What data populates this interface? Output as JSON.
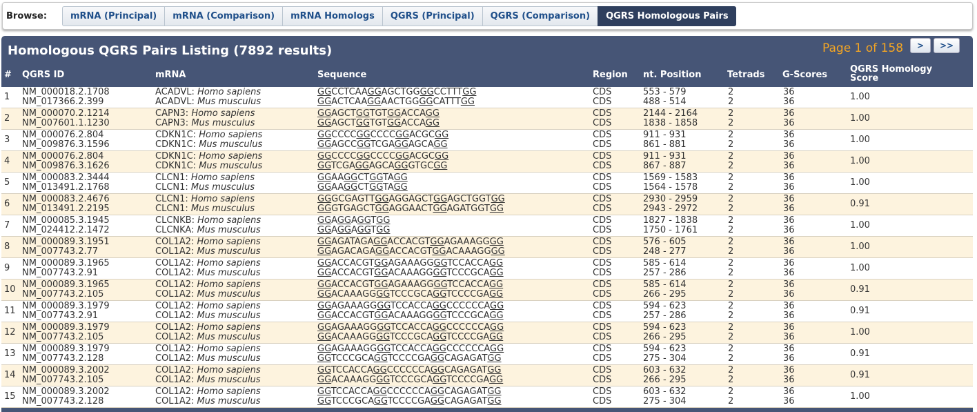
{
  "browse": {
    "label": "Browse:",
    "tabs": [
      {
        "label": "mRNA (Principal)"
      },
      {
        "label": "mRNA (Comparison)"
      },
      {
        "label": "mRNA Homologs"
      },
      {
        "label": "QGRS (Principal)"
      },
      {
        "label": "QGRS (Comparison)"
      },
      {
        "label": "QGRS Homologous Pairs",
        "active": true
      }
    ]
  },
  "panel": {
    "title": "Homologous QGRS Pairs Listing (7892 results)",
    "pager": {
      "text": "Page 1 of 158",
      "next": ">",
      "last": ">>"
    }
  },
  "columns": {
    "num": "#",
    "qgrs_id": "QGRS ID",
    "mrna": "mRNA",
    "sequence": "Sequence",
    "region": "Region",
    "position": "nt. Position",
    "tetrads": "Tetrads",
    "gscores": "G-Scores",
    "score": "QGRS Homology Score"
  },
  "rows": [
    {
      "n": "1",
      "ids": [
        "NM_000018.2.1708",
        "NM_017366.2.399"
      ],
      "gene": [
        "ACADVL:",
        "ACADVL:"
      ],
      "species": [
        "Homo sapiens",
        "Mus musculus"
      ],
      "seq": [
        [
          "GG",
          "CCTCAA",
          "GG",
          "AGCTGG",
          "GG",
          "CCTTT",
          "GG"
        ],
        [
          "GG",
          "ACTCAA",
          "GG",
          "AACTGG",
          "GG",
          "CATTT",
          "GG"
        ]
      ],
      "region": [
        "CDS",
        "CDS"
      ],
      "pos": [
        "553 - 579",
        "488 - 514"
      ],
      "tetrads": [
        "2",
        "2"
      ],
      "gs": [
        "36",
        "36"
      ],
      "score": "1.00"
    },
    {
      "n": "2",
      "ids": [
        "NM_000070.2.1214",
        "NM_007601.1.1230"
      ],
      "gene": [
        "CAPN3:",
        "CAPN3:"
      ],
      "species": [
        "Homo sapiens",
        "Mus musculus"
      ],
      "seq": [
        [
          "GG",
          "AGCT",
          "GG",
          "TGT",
          "GG",
          "ACCA",
          "GG"
        ],
        [
          "GG",
          "AGCT",
          "GG",
          "TGT",
          "GG",
          "ACCA",
          "GG"
        ]
      ],
      "region": [
        "CDS",
        "CDS"
      ],
      "pos": [
        "2144 - 2164",
        "1838 - 1858"
      ],
      "tetrads": [
        "2",
        "2"
      ],
      "gs": [
        "36",
        "36"
      ],
      "score": "1.00"
    },
    {
      "n": "3",
      "ids": [
        "NM_000076.2.804",
        "NM_009876.3.1596"
      ],
      "gene": [
        "CDKN1C:",
        "CDKN1C:"
      ],
      "species": [
        "Homo sapiens",
        "Mus musculus"
      ],
      "seq": [
        [
          "GG",
          "CCCC",
          "GG",
          "CCCC",
          "GG",
          "ACGC",
          "GG"
        ],
        [
          "GG",
          "AGCC",
          "GG",
          "TCGA",
          "GG",
          "AGCA",
          "GG"
        ]
      ],
      "region": [
        "CDS",
        "CDS"
      ],
      "pos": [
        "911 - 931",
        "861 - 881"
      ],
      "tetrads": [
        "2",
        "2"
      ],
      "gs": [
        "36",
        "36"
      ],
      "score": "1.00"
    },
    {
      "n": "4",
      "ids": [
        "NM_000076.2.804",
        "NM_009876.3.1626"
      ],
      "gene": [
        "CDKN1C:",
        "CDKN1C:"
      ],
      "species": [
        "Homo sapiens",
        "Mus musculus"
      ],
      "seq": [
        [
          "GG",
          "CCCC",
          "GG",
          "CCCC",
          "GG",
          "ACGC",
          "GG"
        ],
        [
          "GG",
          "TCGA",
          "GG",
          "AGCA",
          "GG",
          "GTGC",
          "GG"
        ]
      ],
      "region": [
        "CDS",
        "CDS"
      ],
      "pos": [
        "911 - 931",
        "867 - 887"
      ],
      "tetrads": [
        "2",
        "2"
      ],
      "gs": [
        "36",
        "36"
      ],
      "score": "1.00"
    },
    {
      "n": "5",
      "ids": [
        "NM_000083.2.3444",
        "NM_013491.2.1768"
      ],
      "gene": [
        "CLCN1:",
        "CLCN1:"
      ],
      "species": [
        "Homo sapiens",
        "Mus musculus"
      ],
      "seq": [
        [
          "GG",
          "AA",
          "GG",
          "CT",
          "GG",
          "TA",
          "GG"
        ],
        [
          "GG",
          "AA",
          "GG",
          "CT",
          "GG",
          "TA",
          "GG"
        ]
      ],
      "region": [
        "CDS",
        "CDS"
      ],
      "pos": [
        "1569 - 1583",
        "1564 - 1578"
      ],
      "tetrads": [
        "2",
        "2"
      ],
      "gs": [
        "36",
        "36"
      ],
      "score": "1.00"
    },
    {
      "n": "6",
      "ids": [
        "NM_000083.2.4676",
        "NM_013491.2.2195"
      ],
      "gene": [
        "CLCN1:",
        "CLCN1:"
      ],
      "species": [
        "Homo sapiens",
        "Mus musculus"
      ],
      "seq": [
        [
          "GG",
          "GCGAGTT",
          "GG",
          "AGGAGCT",
          "GG",
          "AGCTGGT",
          "GG"
        ],
        [
          "GG",
          "GTGAGCT",
          "GG",
          "AGGAACT",
          "GG",
          "AGATGGT",
          "GG"
        ]
      ],
      "region": [
        "CDS",
        "CDS"
      ],
      "pos": [
        "2930 - 2959",
        "2943 - 2972"
      ],
      "tetrads": [
        "2",
        "2"
      ],
      "gs": [
        "36",
        "36"
      ],
      "score": "0.91"
    },
    {
      "n": "7",
      "ids": [
        "NM_000085.3.1945",
        "NM_024412.2.1472"
      ],
      "gene": [
        "CLCNKB:",
        "CLCNKA:"
      ],
      "species": [
        "Homo sapiens",
        "Mus musculus"
      ],
      "seq": [
        [
          "GG",
          "A",
          "GG",
          "A",
          "GG",
          "T",
          "GG"
        ],
        [
          "GG",
          "A",
          "GG",
          "A",
          "GG",
          "T",
          "GG"
        ]
      ],
      "region": [
        "CDS",
        "CDS"
      ],
      "pos": [
        "1827 - 1838",
        "1750 - 1761"
      ],
      "tetrads": [
        "2",
        "2"
      ],
      "gs": [
        "36",
        "36"
      ],
      "score": "1.00"
    },
    {
      "n": "8",
      "ids": [
        "NM_000089.3.1951",
        "NM_007743.2.77"
      ],
      "gene": [
        "COL1A2:",
        "COL1A2:"
      ],
      "species": [
        "Homo sapiens",
        "Mus musculus"
      ],
      "seq": [
        [
          "GG",
          "AGATAGA",
          "GG",
          "ACCACGT",
          "GG",
          "AGAAAGG",
          "GG"
        ],
        [
          "GG",
          "AGACAGA",
          "GG",
          "ACCACGT",
          "GG",
          "ACAAAGG",
          "GG"
        ]
      ],
      "region": [
        "CDS",
        "CDS"
      ],
      "pos": [
        "576 - 605",
        "248 - 277"
      ],
      "tetrads": [
        "2",
        "2"
      ],
      "gs": [
        "36",
        "36"
      ],
      "score": "1.00"
    },
    {
      "n": "9",
      "ids": [
        "NM_000089.3.1965",
        "NM_007743.2.91"
      ],
      "gene": [
        "COL1A2:",
        "COL1A2:"
      ],
      "species": [
        "Homo sapiens",
        "Mus musculus"
      ],
      "seq": [
        [
          "GG",
          "ACCACGT",
          "GG",
          "AGAAAGG",
          "GG",
          "TCCACCA",
          "GG"
        ],
        [
          "GG",
          "ACCACGT",
          "GG",
          "ACAAAGG",
          "GG",
          "TCCCGCA",
          "GG"
        ]
      ],
      "region": [
        "CDS",
        "CDS"
      ],
      "pos": [
        "585 - 614",
        "257 - 286"
      ],
      "tetrads": [
        "2",
        "2"
      ],
      "gs": [
        "36",
        "36"
      ],
      "score": "1.00"
    },
    {
      "n": "10",
      "ids": [
        "NM_000089.3.1965",
        "NM_007743.2.105"
      ],
      "gene": [
        "COL1A2:",
        "COL1A2:"
      ],
      "species": [
        "Homo sapiens",
        "Mus musculus"
      ],
      "seq": [
        [
          "GG",
          "ACCACGT",
          "GG",
          "AGAAAGG",
          "GG",
          "TCCACCA",
          "GG"
        ],
        [
          "GG",
          "ACAAAGG",
          "GG",
          "TCCCGCA",
          "GG",
          "TCCCCGA",
          "GG"
        ]
      ],
      "region": [
        "CDS",
        "CDS"
      ],
      "pos": [
        "585 - 614",
        "266 - 295"
      ],
      "tetrads": [
        "2",
        "2"
      ],
      "gs": [
        "36",
        "36"
      ],
      "score": "0.91"
    },
    {
      "n": "11",
      "ids": [
        "NM_000089.3.1979",
        "NM_007743.2.91"
      ],
      "gene": [
        "COL1A2:",
        "COL1A2:"
      ],
      "species": [
        "Homo sapiens",
        "Mus musculus"
      ],
      "seq": [
        [
          "GG",
          "AGAAAGG",
          "GG",
          "TCCACCA",
          "GG",
          "CCCCCCA",
          "GG"
        ],
        [
          "GG",
          "ACCACGT",
          "GG",
          "ACAAAGG",
          "GG",
          "TCCCGCA",
          "GG"
        ]
      ],
      "region": [
        "CDS",
        "CDS"
      ],
      "pos": [
        "594 - 623",
        "257 - 286"
      ],
      "tetrads": [
        "2",
        "2"
      ],
      "gs": [
        "36",
        "36"
      ],
      "score": "0.91"
    },
    {
      "n": "12",
      "ids": [
        "NM_000089.3.1979",
        "NM_007743.2.105"
      ],
      "gene": [
        "COL1A2:",
        "COL1A2:"
      ],
      "species": [
        "Homo sapiens",
        "Mus musculus"
      ],
      "seq": [
        [
          "GG",
          "AGAAAGG",
          "GG",
          "TCCACCA",
          "GG",
          "CCCCCCA",
          "GG"
        ],
        [
          "GG",
          "ACAAAGG",
          "GG",
          "TCCCGCA",
          "GG",
          "TCCCCGA",
          "GG"
        ]
      ],
      "region": [
        "CDS",
        "CDS"
      ],
      "pos": [
        "594 - 623",
        "266 - 295"
      ],
      "tetrads": [
        "2",
        "2"
      ],
      "gs": [
        "36",
        "36"
      ],
      "score": "1.00"
    },
    {
      "n": "13",
      "ids": [
        "NM_000089.3.1979",
        "NM_007743.2.128"
      ],
      "gene": [
        "COL1A2:",
        "COL1A2:"
      ],
      "species": [
        "Homo sapiens",
        "Mus musculus"
      ],
      "seq": [
        [
          "GG",
          "AGAAAGG",
          "GG",
          "TCCACCA",
          "GG",
          "CCCCCCA",
          "GG"
        ],
        [
          "GG",
          "TCCCGCA",
          "GG",
          "TCCCCGA",
          "GG",
          "CAGAGAT",
          "GG"
        ]
      ],
      "region": [
        "CDS",
        "CDS"
      ],
      "pos": [
        "594 - 623",
        "275 - 304"
      ],
      "tetrads": [
        "2",
        "2"
      ],
      "gs": [
        "36",
        "36"
      ],
      "score": "0.91"
    },
    {
      "n": "14",
      "ids": [
        "NM_000089.3.2002",
        "NM_007743.2.105"
      ],
      "gene": [
        "COL1A2:",
        "COL1A2:"
      ],
      "species": [
        "Homo sapiens",
        "Mus musculus"
      ],
      "seq": [
        [
          "GG",
          "TCCACCA",
          "GG",
          "CCCCCCA",
          "GG",
          "CAGAGAT",
          "GG"
        ],
        [
          "GG",
          "ACAAAGG",
          "GG",
          "TCCCGCA",
          "GG",
          "TCCCCGA",
          "GG"
        ]
      ],
      "region": [
        "CDS",
        "CDS"
      ],
      "pos": [
        "603 - 632",
        "266 - 295"
      ],
      "tetrads": [
        "2",
        "2"
      ],
      "gs": [
        "36",
        "36"
      ],
      "score": "0.91"
    },
    {
      "n": "15",
      "ids": [
        "NM_000089.3.2002",
        "NM_007743.2.128"
      ],
      "gene": [
        "COL1A2:",
        "COL1A2:"
      ],
      "species": [
        "Homo sapiens",
        "Mus musculus"
      ],
      "seq": [
        [
          "GG",
          "TCCACCA",
          "GG",
          "CCCCCCA",
          "GG",
          "CAGAGAT",
          "GG"
        ],
        [
          "GG",
          "TCCCGCA",
          "GG",
          "TCCCCGA",
          "GG",
          "CAGAGAT",
          "GG"
        ]
      ],
      "region": [
        "CDS",
        "CDS"
      ],
      "pos": [
        "603 - 632",
        "275 - 304"
      ],
      "tetrads": [
        "2",
        "2"
      ],
      "gs": [
        "36",
        "36"
      ],
      "score": "1.00"
    }
  ]
}
